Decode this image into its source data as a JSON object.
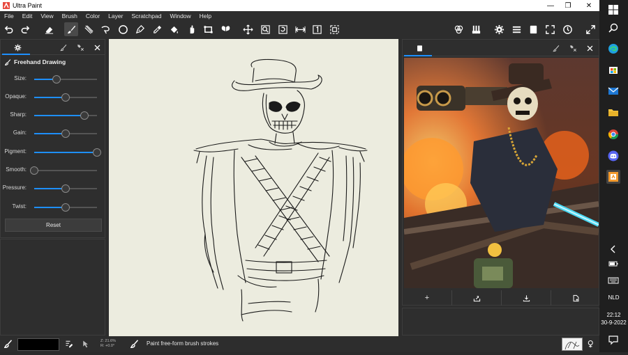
{
  "window": {
    "title": "Ultra Paint",
    "minimize": "—",
    "maximize": "❐",
    "close": "✕"
  },
  "menu": [
    "File",
    "Edit",
    "View",
    "Brush",
    "Color",
    "Layer",
    "Scratchpad",
    "Window",
    "Help"
  ],
  "toolbar": {
    "left_tools": [
      "undo-icon",
      "redo-icon",
      "eraser-icon",
      "brush-icon",
      "smudge-icon",
      "lasso-icon",
      "ellipse-icon",
      "pen-icon",
      "eyedropper-icon",
      "fill-icon",
      "move-icon",
      "rectangle-icon",
      "butterfly-icon",
      "transform-icon",
      "zoom-icon",
      "rotate-icon",
      "flip-icon",
      "one-to-one-icon",
      "fit-icon"
    ],
    "right_tools": [
      "color-mixer-icon",
      "brushes-icon",
      "settings-icon",
      "layers-icon",
      "reference-icon",
      "fullscreen-icon",
      "timer-icon",
      "expand-icon"
    ],
    "active_tool": "brush-icon"
  },
  "brush_panel": {
    "title": "Freehand Drawing",
    "sliders": [
      {
        "label": "Size:",
        "value": 0.35
      },
      {
        "label": "Opaque:",
        "value": 0.5
      },
      {
        "label": "Sharp:",
        "value": 0.8
      },
      {
        "label": "Gain:",
        "value": 0.5
      },
      {
        "label": "Pigment:",
        "value": 1.0
      },
      {
        "label": "Smooth:",
        "value": 0.0
      },
      {
        "label": "Pressure:",
        "value": 0.5
      },
      {
        "label": "Twist:",
        "value": 0.5
      }
    ],
    "reset_label": "Reset"
  },
  "reference_panel": {
    "actions": [
      "+",
      "import-icon",
      "download-icon",
      "new-file-icon"
    ]
  },
  "status": {
    "color": "#000000",
    "coords": [
      "Z: 21.6%",
      "R: +0.0°"
    ],
    "hint": "Paint free-form brush strokes"
  },
  "taskbar": {
    "language": "NLD",
    "time": "22:12",
    "date": "30-9-2022"
  },
  "colors": {
    "accent": "#1e90ff",
    "canvas": "#ececdf",
    "panel": "#2e2e2e"
  }
}
